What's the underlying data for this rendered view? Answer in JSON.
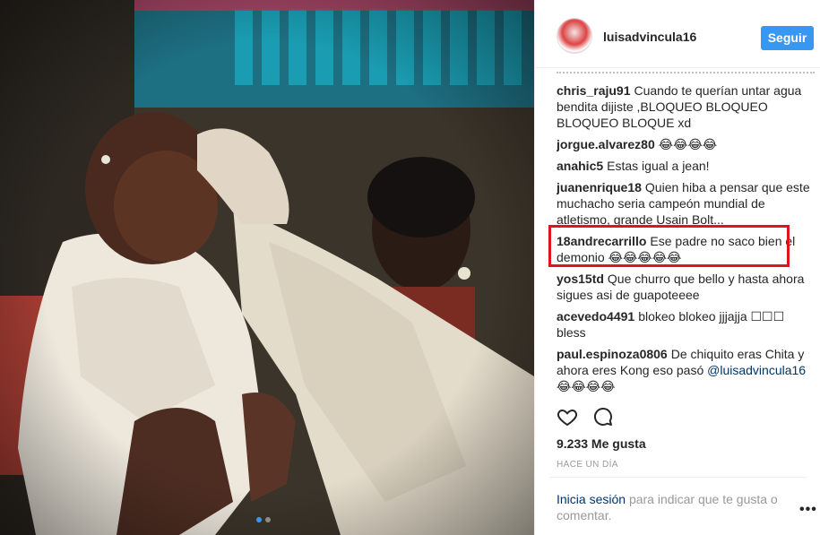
{
  "post": {
    "username": "luisadvincula16",
    "follow_label": "Seguir",
    "likes": "9.233 Me gusta",
    "time": "Hace un día",
    "login_link": "Inicia sesión",
    "login_rest": "para indicar que te gusta o comentar.",
    "carousel_dots": 2,
    "carousel_active": 0
  },
  "comments": [
    {
      "author": "chris_raju91",
      "text": "Cuando te querían untar agua bendita dijiste ,BLOQUEO BLOQUEO BLOQUEO BLOQUE xd"
    },
    {
      "author": "jorgue.alvarez80",
      "text": "😂😂😂😂"
    },
    {
      "author": "anahic5",
      "text": "Estas igual a jean!"
    },
    {
      "author": "juanenrique18",
      "text": "Quien hiba a pensar que este muchacho seria campeón mundial de atletismo, grande Usain Bolt..."
    },
    {
      "author": "18andrecarrillo",
      "text": "Ese padre no saco bien el demonio 😂😂😂😂😂"
    },
    {
      "author": "yos15td",
      "text": "Que churro que bello y hasta ahora sigues asi de guapoteeee"
    },
    {
      "author": "acevedo4491",
      "text": "blokeo blokeo jjjajja ☐☐☐ bless"
    },
    {
      "author": "paul.espinoza0806",
      "text": "De chiquito eras Chita y ahora eres Kong eso pasó",
      "mention": "@luisadvincula16",
      "after": "😂😂😂😂"
    }
  ],
  "icons": {
    "like": "heart-icon",
    "comment": "comment-icon",
    "more": "more-options-icon"
  },
  "colors": {
    "follow_button": "#3897f0",
    "link": "#003569",
    "highlight_box": "#e0141e",
    "muted": "#999999"
  }
}
